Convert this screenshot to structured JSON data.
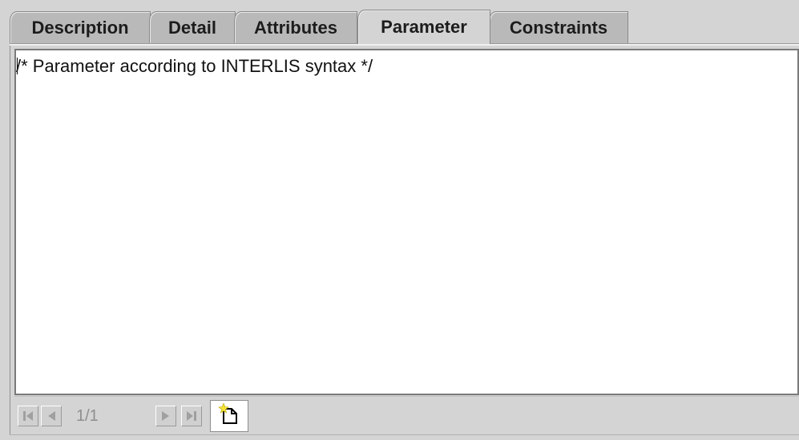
{
  "tabs": [
    {
      "label": "Description",
      "active": false
    },
    {
      "label": "Detail",
      "active": false
    },
    {
      "label": "Attributes",
      "active": false
    },
    {
      "label": "Parameter",
      "active": true
    },
    {
      "label": "Constraints",
      "active": false
    }
  ],
  "editor": {
    "text": "/* Parameter according to INTERLIS syntax */"
  },
  "navigator": {
    "page_indicator": "1/1",
    "first_icon": "first-page-icon",
    "prev_icon": "previous-page-icon",
    "next_icon": "next-page-icon",
    "last_icon": "last-page-icon",
    "new_icon": "new-document-icon"
  },
  "colors": {
    "tab_inactive": "#b9b9b9",
    "tab_active": "#d4d4d4",
    "disabled_icon": "#a0a0a0",
    "new_icon_star": "#f5e43a"
  }
}
